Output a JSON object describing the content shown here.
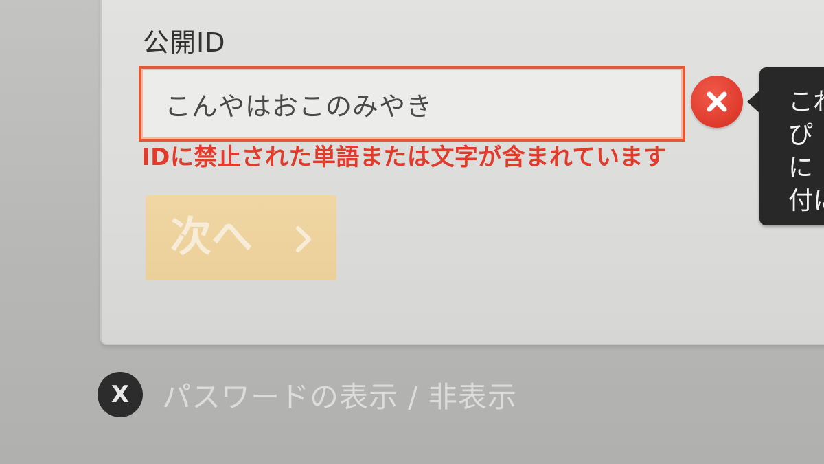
{
  "form": {
    "field_label": "公開ID",
    "input_value": "こんやはおこのみやき",
    "error_message": "IDに禁止された単語または文字が含まれています",
    "next_label": "次へ"
  },
  "tooltip": {
    "lines": [
      "これ",
      "ぴ",
      "に",
      "付に"
    ]
  },
  "footer": {
    "button_glyph": "X",
    "toggle_label": "パスワードの表示 / 非表示"
  },
  "icons": {
    "clear": "close-icon",
    "next": "chevron-right-icon"
  },
  "colors": {
    "error": "#e23a2b",
    "input_border": "#e25a32",
    "next_button": "#ecd09a",
    "tooltip_bg": "#282828"
  }
}
